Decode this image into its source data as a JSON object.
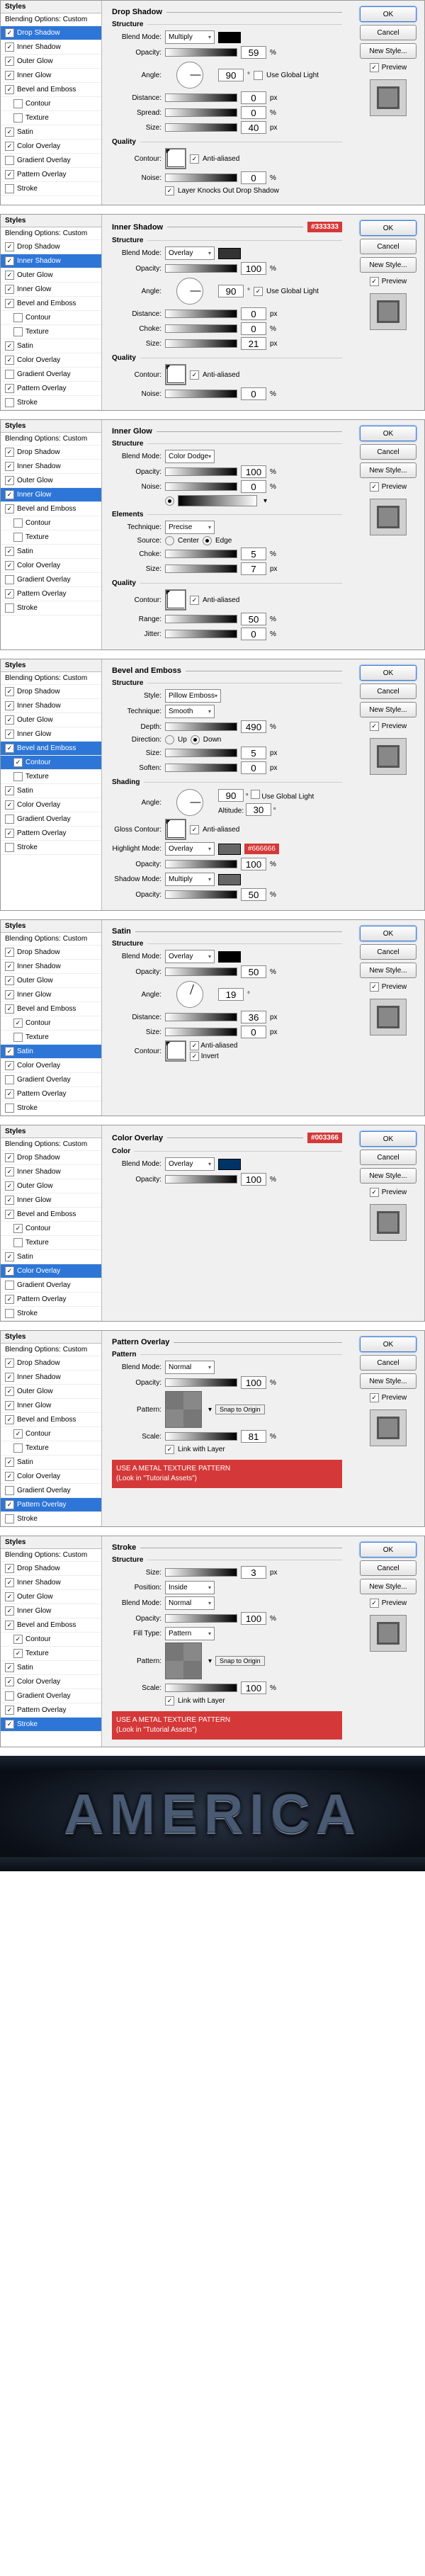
{
  "common": {
    "styles_h": "Styles",
    "blending": "Blending Options: Custom",
    "ok": "OK",
    "cancel": "Cancel",
    "newstyle": "New Style...",
    "preview": "Preview"
  },
  "list": [
    "Drop Shadow",
    "Inner Shadow",
    "Outer Glow",
    "Inner Glow",
    "Bevel and Emboss",
    "Contour",
    "Texture",
    "Satin",
    "Color Overlay",
    "Gradient Overlay",
    "Pattern Overlay",
    "Stroke"
  ],
  "labels": {
    "structure": "Structure",
    "quality": "Quality",
    "elements": "Elements",
    "shading": "Shading",
    "blendmode": "Blend Mode:",
    "opacity": "Opacity:",
    "angle": "Angle:",
    "usegl": "Use Global Light",
    "distance": "Distance:",
    "spread": "Spread:",
    "size": "Size:",
    "contour": "Contour:",
    "aa": "Anti-aliased",
    "noise": "Noise:",
    "knockout": "Layer Knocks Out Drop Shadow",
    "choke": "Choke:",
    "technique": "Technique:",
    "source": "Source:",
    "center": "Center",
    "edge": "Edge",
    "range": "Range:",
    "jitter": "Jitter:",
    "style": "Style:",
    "depth": "Depth:",
    "direction": "Direction:",
    "up": "Up",
    "down": "Down",
    "soften": "Soften:",
    "altitude": "Altitude:",
    "glosscontour": "Gloss Contour:",
    "highlight": "Highlight Mode:",
    "shadowmode": "Shadow Mode:",
    "invert": "Invert",
    "color": "Color",
    "pattern": "Pattern",
    "scale": "Scale:",
    "snap": "Snap to Origin",
    "link": "Link with Layer",
    "position": "Position:",
    "filltype": "Fill Type:",
    "pct": "%",
    "px": "px",
    "deg": "°"
  },
  "p1": {
    "title": "Drop Shadow",
    "checked": [
      0,
      1,
      2,
      3,
      4,
      7,
      8,
      10
    ],
    "sel": 0,
    "bm": "Multiply",
    "op": 59,
    "ang": 90,
    "dist": 0,
    "spread": 0,
    "size": 40,
    "noise": 0,
    "color": "#000000"
  },
  "p2": {
    "title": "Inner Shadow",
    "tag": "#333333",
    "checked": [
      0,
      1,
      2,
      3,
      4,
      7,
      8,
      10
    ],
    "sel": 1,
    "bm": "Overlay",
    "op": 100,
    "ang": 90,
    "dist": 0,
    "choke": 0,
    "size": 21,
    "noise": 0,
    "color": "#333333"
  },
  "p3": {
    "title": "Inner Glow",
    "checked": [
      0,
      1,
      2,
      3,
      4,
      7,
      8,
      10
    ],
    "sel": 3,
    "bm": "Color Dodge",
    "op": 100,
    "noise": 0,
    "tech": "Precise",
    "choke": 5,
    "size": 7,
    "range": 50,
    "jitter": 0
  },
  "p4": {
    "title": "Bevel and Emboss",
    "checked": [
      0,
      1,
      2,
      3,
      4,
      5,
      7,
      8,
      10
    ],
    "sel": 4,
    "subsel": 5,
    "style": "Pillow Emboss",
    "tech": "Smooth",
    "depth": 490,
    "size": 5,
    "soften": 0,
    "ang": 90,
    "alt": 30,
    "hm": "Overlay",
    "hop": 100,
    "sm": "Multiply",
    "sop": 50,
    "tag": "#666666"
  },
  "p5": {
    "title": "Satin",
    "checked": [
      0,
      1,
      2,
      3,
      4,
      5,
      7,
      8,
      10
    ],
    "sel": 7,
    "bm": "Overlay",
    "op": 50,
    "ang": 19,
    "dist": 36,
    "size": 0,
    "color": "#000000"
  },
  "p6": {
    "title": "Color Overlay",
    "tag": "#003366",
    "checked": [
      0,
      1,
      2,
      3,
      4,
      5,
      7,
      8,
      10
    ],
    "sel": 8,
    "bm": "Overlay",
    "op": 100,
    "color": "#003366"
  },
  "p7": {
    "title": "Pattern Overlay",
    "checked": [
      0,
      1,
      2,
      3,
      4,
      5,
      7,
      8,
      10
    ],
    "sel": 10,
    "bm": "Normal",
    "op": 100,
    "scale": 81,
    "warn": "USE A METAL TEXTURE PATTERN\n(Look in \"Tutorial Assets\")"
  },
  "p8": {
    "title": "Stroke",
    "checked": [
      0,
      1,
      2,
      3,
      4,
      5,
      6,
      7,
      8,
      10,
      11
    ],
    "sel": 11,
    "size": 3,
    "pos": "Inside",
    "bm": "Normal",
    "op": 100,
    "ft": "Pattern",
    "scale": 100,
    "warn": "USE A METAL TEXTURE PATTERN\n(Look in \"Tutorial Assets\")"
  },
  "result": "AMERICA"
}
